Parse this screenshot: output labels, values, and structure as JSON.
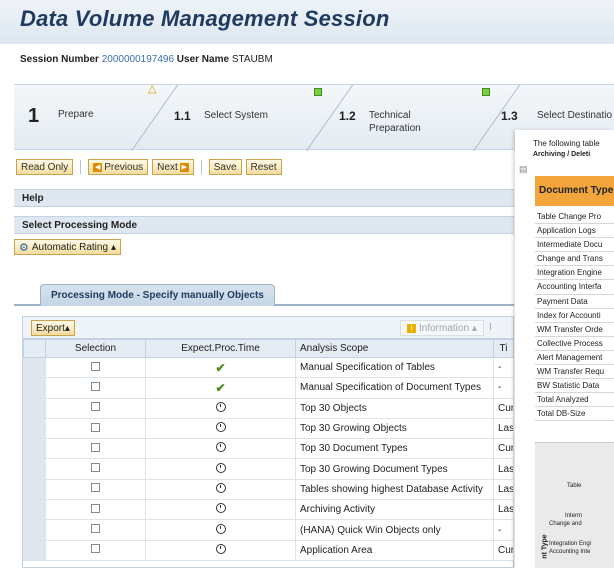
{
  "window": {
    "title": "Data Volume Management Session"
  },
  "session": {
    "number_label": "Session Number",
    "number_value": "2000000197496",
    "user_label": "User Name",
    "user_value": "STAUBM"
  },
  "roadmap": {
    "steps": [
      {
        "num": "1",
        "label": "Prepare",
        "status": "warning"
      },
      {
        "num": "1.1",
        "label": "Select System",
        "status": "ok"
      },
      {
        "num": "1.2",
        "label": "Technical",
        "label2": "Preparation",
        "status": "ok"
      },
      {
        "num": "1.3",
        "label": "Select Destinatio",
        "status": "none"
      }
    ]
  },
  "toolbar": {
    "read_only": "Read Only",
    "previous": "Previous",
    "next": "Next",
    "save": "Save",
    "reset": "Reset"
  },
  "sections": {
    "help": "Help",
    "processing_mode": "Select Processing Mode",
    "automatic_rating": "Automatic Rating"
  },
  "tab": {
    "label": "Processing Mode - Specify manually Objects"
  },
  "grid": {
    "export_label": "Export",
    "info_label": "Information",
    "more_header": "I",
    "columns": [
      "Selection",
      "Expect.Proc.Time",
      "Analysis Scope",
      "Ti"
    ],
    "rows": [
      {
        "time": "check",
        "scope": "Manual Specification of Tables",
        "extra": "-"
      },
      {
        "time": "check",
        "scope": "Manual Specification of Document Types",
        "extra": "-"
      },
      {
        "time": "clock",
        "scope": "Top 30 Objects",
        "extra": "Cur"
      },
      {
        "time": "clock",
        "scope": "Top 30 Growing Objects",
        "extra": "Las"
      },
      {
        "time": "clock",
        "scope": "Top 30 Document Types",
        "extra": "Cur"
      },
      {
        "time": "clock",
        "scope": "Top 30 Growing Document Types",
        "extra": "Las"
      },
      {
        "time": "clock",
        "scope": "Tables showing highest Database Activity",
        "extra": "Las"
      },
      {
        "time": "clock",
        "scope": "Archiving Activity",
        "extra": "Las"
      },
      {
        "time": "clock",
        "scope": "(HANA) Quick Win Objects only",
        "extra": "-"
      },
      {
        "time": "clock",
        "scope": "Application Area",
        "extra": "Cur"
      }
    ]
  },
  "side_panel": {
    "intro": "The following table",
    "caps": "Archiving / Deleti",
    "header": "Document  Type",
    "rows": [
      "Table Change Pro",
      "Application Logs",
      "Intermediate Docu",
      "Change and Trans",
      "Integration Engine",
      "Accounting Interfa",
      "Payment Data",
      "Index for Accounti",
      "WM Transfer Orde",
      "Collective Process",
      "Alert Management",
      "WM Transfer Requ",
      "BW Statistic Data",
      "Total Analyzed",
      "Total DB-Size"
    ],
    "chart_labels": [
      "Table",
      "Interm",
      "Change and",
      "Integration Engi",
      "Accounting Inte"
    ],
    "chart_axis": "nt Type"
  }
}
